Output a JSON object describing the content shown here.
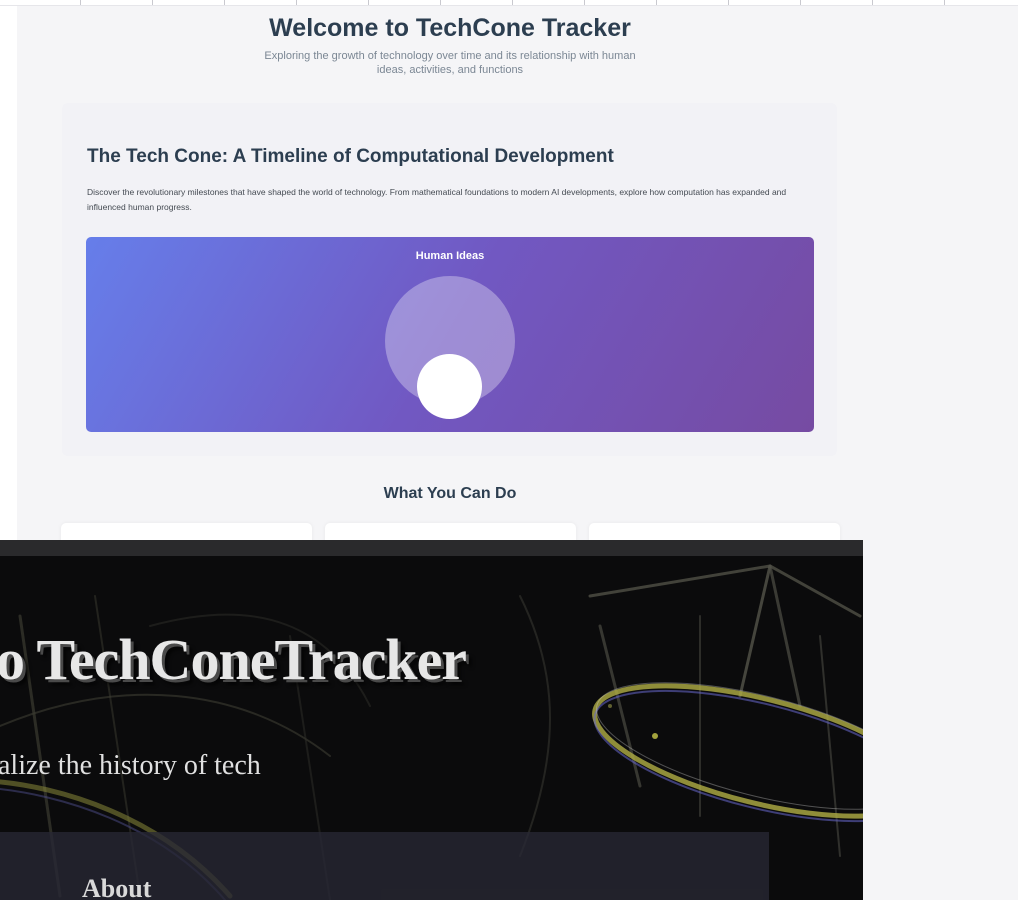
{
  "light_page": {
    "title": "Welcome to TechCone Tracker",
    "subtitle": "Exploring the growth of technology over time and its relationship with human ideas, activities, and functions",
    "cone_section": {
      "heading": "The Tech Cone: A Timeline of Computational Development",
      "description": "Discover the revolutionary milestones that have shaped the world of technology. From mathematical foundations to modern AI developments, explore how computation has expanded and influenced human progress.",
      "visual_label": "Human Ideas",
      "gradient_start": "#667eea",
      "gradient_end": "#764ba2"
    },
    "features_heading": "What You Can Do"
  },
  "dark_page": {
    "title": "o TechConeTracker",
    "subtitle": "alize the history of tech",
    "section_heading": "About"
  }
}
